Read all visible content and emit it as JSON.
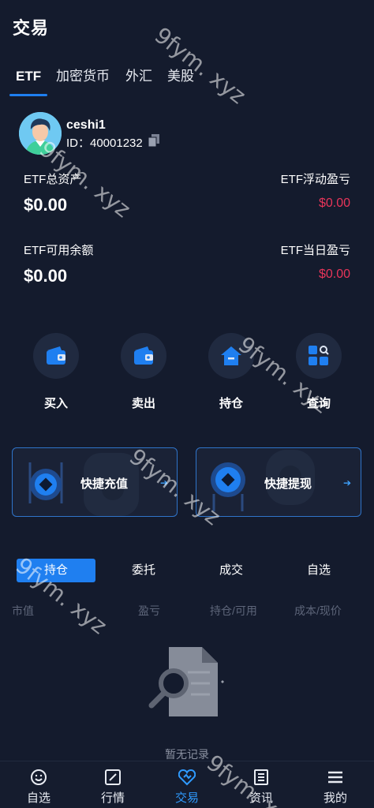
{
  "header": {
    "title": "交易"
  },
  "tabs": [
    {
      "label": "ETF"
    },
    {
      "label": "加密货币"
    },
    {
      "label": "外汇"
    },
    {
      "label": "美股"
    }
  ],
  "user": {
    "name": "ceshi1",
    "id_text": "ID：40001232"
  },
  "assets": {
    "total_label": "ETF总资产",
    "total_value": "$0.00",
    "float_label": "ETF浮动盈亏",
    "float_value": "$0.00",
    "available_label": "ETF可用余额",
    "available_value": "$0.00",
    "daily_label": "ETF当日盈亏",
    "daily_value": "$0.00"
  },
  "actions": [
    {
      "label": "买入",
      "icon": "wallet-icon"
    },
    {
      "label": "卖出",
      "icon": "wallet-icon"
    },
    {
      "label": "持仓",
      "icon": "home-icon"
    },
    {
      "label": "查询",
      "icon": "grid-search-icon"
    }
  ],
  "quick": {
    "deposit_label": "快捷充值",
    "withdraw_label": "快捷提现",
    "arrow": "➔"
  },
  "holdings_tabs": [
    {
      "label": "持仓"
    },
    {
      "label": "委托"
    },
    {
      "label": "成交"
    },
    {
      "label": "自选"
    }
  ],
  "columns": [
    "市值",
    "盈亏",
    "持仓/可用",
    "成本/现价"
  ],
  "empty_text": "暂无记录",
  "nav": [
    {
      "label": "自选",
      "icon": "smile-icon"
    },
    {
      "label": "行情",
      "icon": "chart-icon"
    },
    {
      "label": "交易",
      "icon": "trade-icon"
    },
    {
      "label": "资讯",
      "icon": "news-icon"
    },
    {
      "label": "我的",
      "icon": "menu-icon"
    }
  ],
  "watermark": "9fym. xyz",
  "colors": {
    "accent": "#1f7ff0",
    "negative": "#e8355a",
    "background": "#141b2d"
  }
}
